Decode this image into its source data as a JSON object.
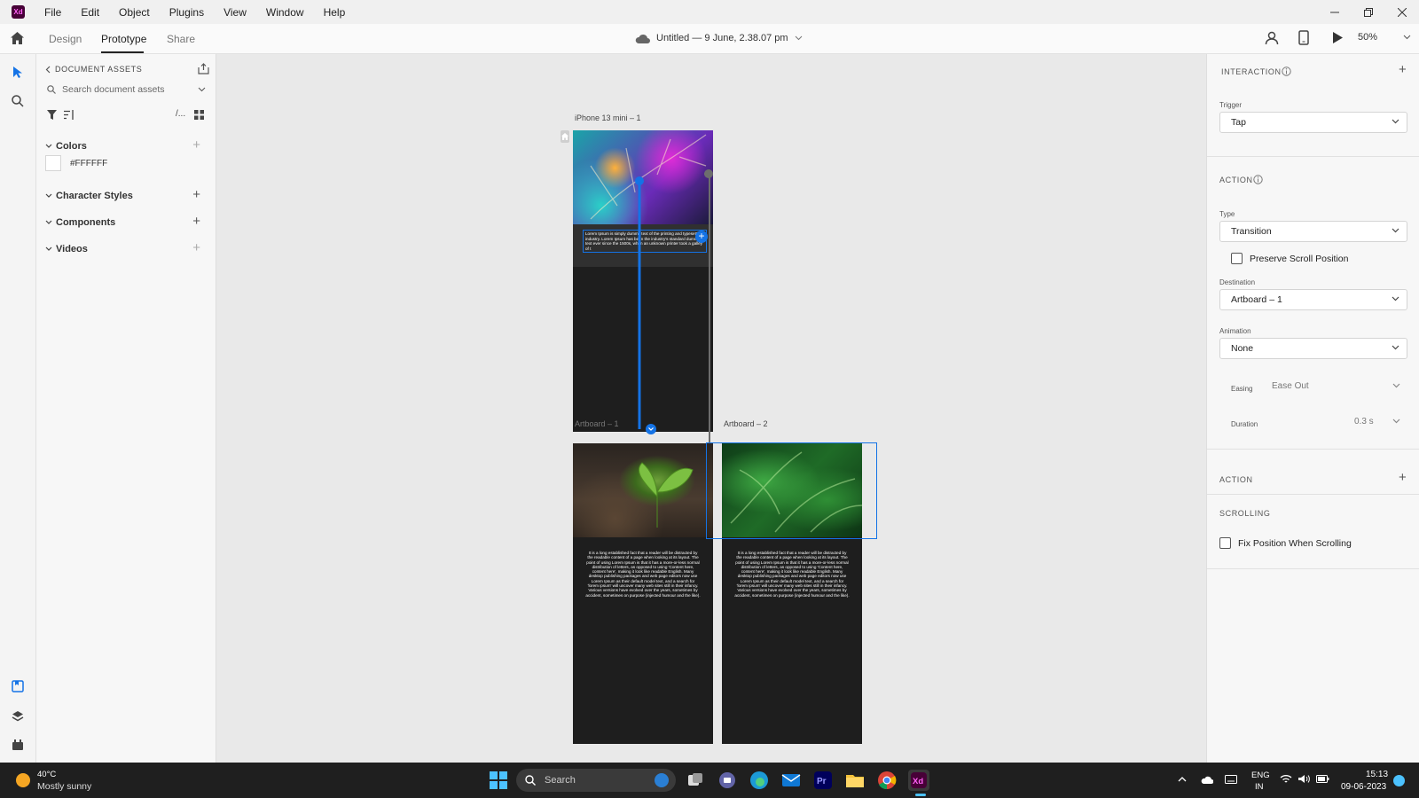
{
  "app": {
    "logo_text": "Xd"
  },
  "menu": {
    "items": [
      "File",
      "Edit",
      "Object",
      "Plugins",
      "View",
      "Window",
      "Help"
    ]
  },
  "toolbar": {
    "tabs": [
      "Design",
      "Prototype",
      "Share"
    ],
    "active_tab": "Prototype",
    "doc_title": "Untitled — 9 June, 2.38.07 pm",
    "zoom": "50%"
  },
  "assets": {
    "header": "DOCUMENT ASSETS",
    "search_placeholder": "Search document assets",
    "view_toggle_text": "/...",
    "sections": {
      "colors": "Colors",
      "character_styles": "Character Styles",
      "components": "Components",
      "videos": "Videos"
    },
    "colors": [
      {
        "hex": "#FFFFFF",
        "label": "#FFFFFF"
      }
    ]
  },
  "canvas": {
    "artboards": [
      {
        "name": "iPhone 13 mini – 1",
        "text": "Lorem Ipsum is simply dummy text of the printing and typesetting industry. Lorem Ipsum has been the industry's standard dummy text ever since the 1500s, when an unknown printer took a galley of t"
      },
      {
        "name": "Artboard – 1",
        "text": "It is a long established fact that a reader will be distracted by the readable content of a page when looking at its layout. The point of using Lorem Ipsum is that it has a more-or-less normal distribution of letters, as opposed to using 'Content here, content here', making it look like readable English. Many desktop publishing packages and web page editors now use Lorem Ipsum as their default model text, and a search for 'lorem ipsum' will uncover many web sites still in their infancy. Various versions have evolved over the years, sometimes by accident, sometimes on purpose (injected humour and the like)."
      },
      {
        "name": "Artboard – 2",
        "text": "It is a long established fact that a reader will be distracted by the readable content of a page when looking at its layout. The point of using Lorem Ipsum is that it has a more-or-less normal distribution of letters, as opposed to using 'Content here, content here', making it look like readable English. Many desktop publishing packages and web page editors now use Lorem Ipsum as their default model text, and a search for 'lorem ipsum' will uncover many web sites still in their infancy. Various versions have evolved over the years, sometimes by accident, sometimes on purpose (injected humour and the like)."
      }
    ]
  },
  "properties": {
    "interaction_title": "INTERACTION",
    "trigger_label": "Trigger",
    "trigger_value": "Tap",
    "action_title": "ACTION",
    "type_label": "Type",
    "type_value": "Transition",
    "preserve_scroll": "Preserve Scroll Position",
    "preserve_scroll_checked": false,
    "destination_label": "Destination",
    "destination_value": "Artboard – 1",
    "animation_label": "Animation",
    "animation_value": "None",
    "easing_label": "Easing",
    "easing_value": "Ease Out",
    "duration_label": "Duration",
    "duration_value": "0.3 s",
    "action2_title": "ACTION",
    "scrolling_title": "SCROLLING",
    "fix_position": "Fix Position When Scrolling",
    "fix_position_checked": false
  },
  "taskbar": {
    "temperature": "40°C",
    "weather": "Mostly sunny",
    "search_placeholder": "Search",
    "lang_top": "ENG",
    "lang_bottom": "IN",
    "time": "15:13",
    "date": "09-06-2023",
    "apps": [
      "start",
      "search",
      "task-view",
      "teams",
      "edge",
      "mail",
      "premiere-pro",
      "file-explorer",
      "chrome",
      "adobe-xd"
    ]
  },
  "colors": {
    "accent_blue": "#1473e6",
    "xd_brand": "#470137",
    "taskbar_bg": "#1f1f1f"
  }
}
